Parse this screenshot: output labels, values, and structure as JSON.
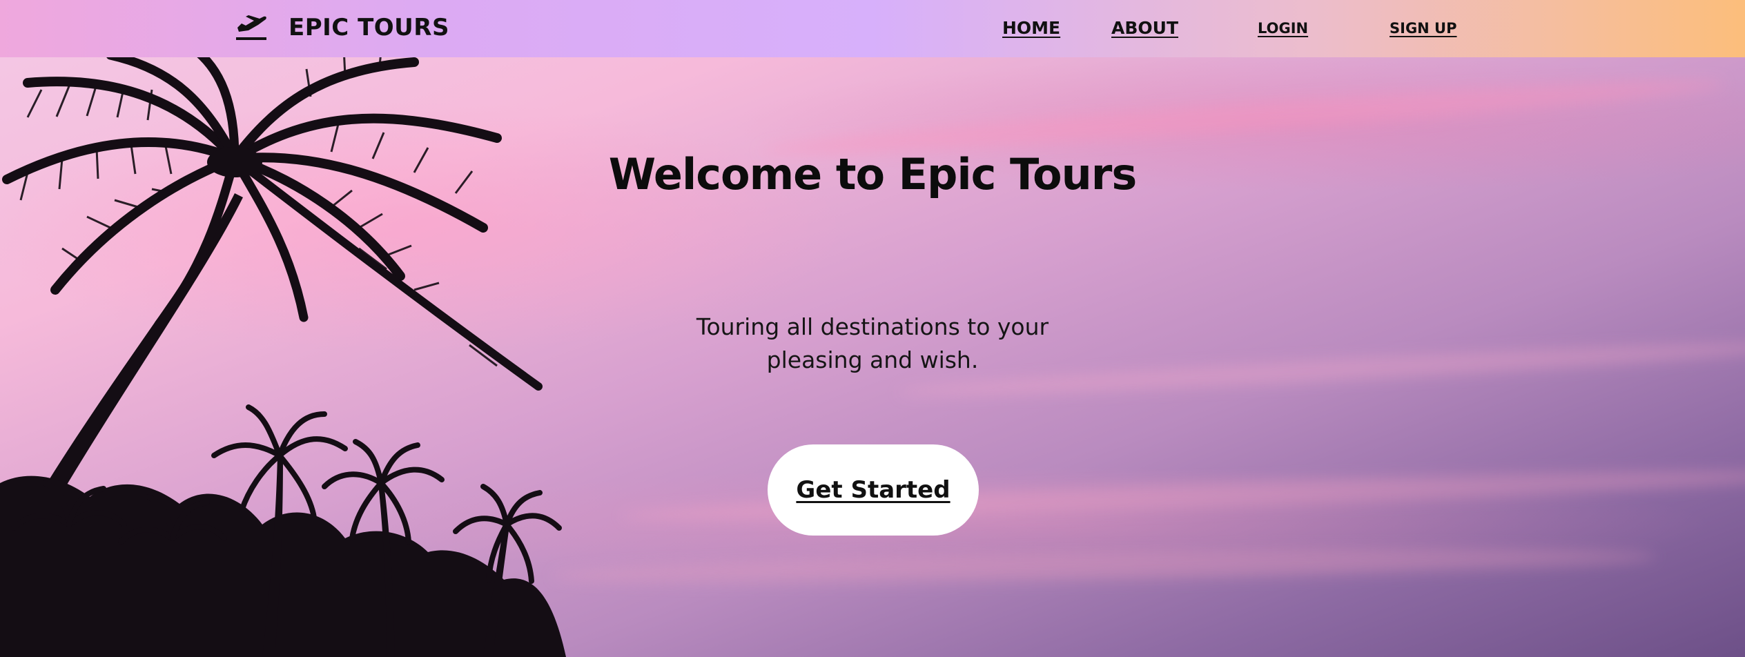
{
  "brand": {
    "name": "EPIC TOURS",
    "icon": "airplane-departure-icon"
  },
  "nav": {
    "home": "HOME",
    "about": "ABOUT",
    "login": "LOGIN",
    "signup": "SIGN UP"
  },
  "hero": {
    "title": "Welcome to Epic Tours",
    "subtitle_line1": "Touring all destinations to your",
    "subtitle_line2": "pleasing and wish.",
    "cta_label": "Get Started",
    "background": "sunset sky with palm tree silhouettes"
  },
  "colors": {
    "nav_gradient": [
      "#efa8dd",
      "#d7b0fb",
      "#fcbe7b"
    ],
    "sky": [
      "#f6bada",
      "#b98bbf",
      "#6d5088"
    ],
    "button": "#ffffff",
    "text": "#111111"
  }
}
